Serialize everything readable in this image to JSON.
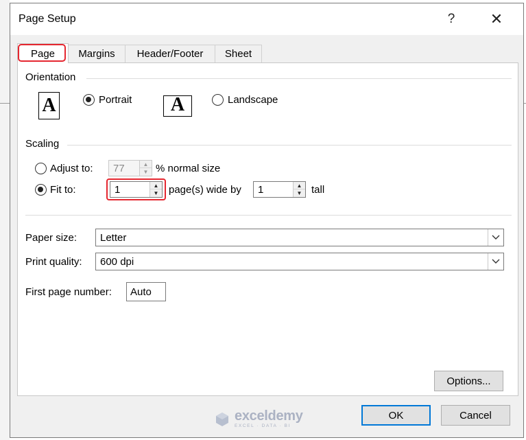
{
  "window": {
    "title": "Page Setup",
    "help_glyph": "?",
    "close_glyph": "✕"
  },
  "tabs": [
    {
      "label": "Page",
      "active": true
    },
    {
      "label": "Margins",
      "active": false
    },
    {
      "label": "Header/Footer",
      "active": false
    },
    {
      "label": "Sheet",
      "active": false
    }
  ],
  "orientation": {
    "group_label": "Orientation",
    "portrait_glyph": "A",
    "landscape_glyph": "A",
    "portrait_label": "Portrait",
    "landscape_label": "Landscape",
    "selected": "portrait"
  },
  "scaling": {
    "group_label": "Scaling",
    "adjust_to_label": "Adjust to:",
    "adjust_to_value": "77",
    "adjust_to_suffix": "% normal size",
    "fit_to_label": "Fit to:",
    "pages_wide_value": "1",
    "pages_wide_suffix": "page(s) wide by",
    "pages_tall_value": "1",
    "pages_tall_suffix": "tall",
    "selected": "fit_to"
  },
  "paper_size": {
    "label": "Paper size:",
    "value": "Letter"
  },
  "print_quality": {
    "label": "Print quality:",
    "value": "600 dpi"
  },
  "first_page_number": {
    "label": "First page number:",
    "value": "Auto"
  },
  "buttons": {
    "options": "Options...",
    "ok": "OK",
    "cancel": "Cancel"
  },
  "watermark": {
    "name": "exceldemy",
    "tagline": "EXCEL · DATA · BI"
  },
  "colors": {
    "highlight": "#e5262f",
    "focus_border": "#0078d7",
    "dialog_bg": "#f0f0f0"
  }
}
